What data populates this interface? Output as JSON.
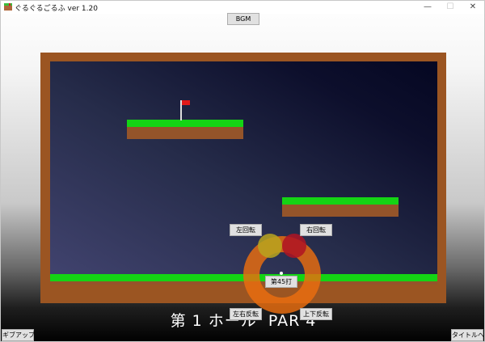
{
  "window": {
    "title": "ぐるぐるごるふ ver 1.20",
    "minimize_glyph": "—",
    "maximize_glyph": "☐",
    "close_glyph": "✕"
  },
  "toolbar": {
    "bgm_label": "BGM"
  },
  "controls": {
    "rotate_left_label": "左回転",
    "rotate_right_label": "右回転",
    "shot_label": "第45打",
    "flip_horizontal_label": "左右反転",
    "flip_vertical_label": "上下反転"
  },
  "hole": {
    "label": "第 1 ホール  PAR 4"
  },
  "footer": {
    "give_up_label": "ギブアップ",
    "to_title_label": "タイトルへ"
  },
  "colors": {
    "grass": "#14d414",
    "dirt": "#94542a",
    "frame": "#9b5522",
    "flag": "#e01818",
    "ring": "#eb6e0f"
  },
  "icons": [
    "app-icon",
    "flag-icon"
  ]
}
